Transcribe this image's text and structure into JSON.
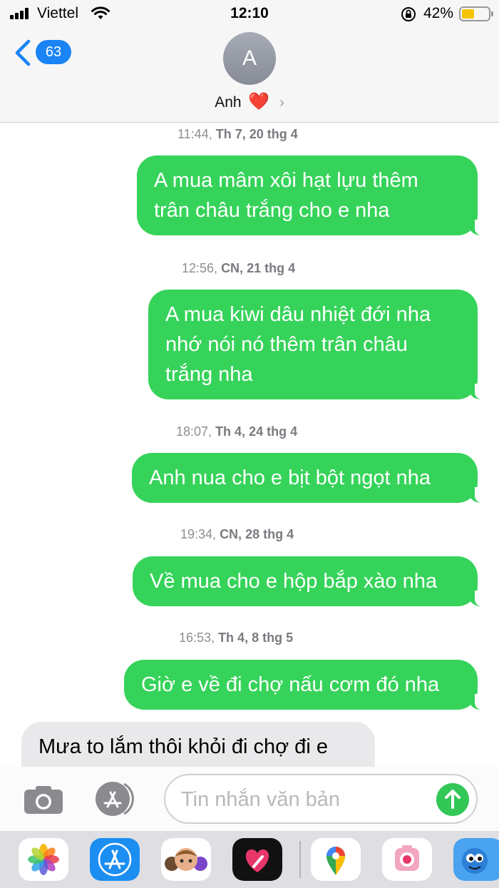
{
  "status_bar": {
    "carrier": "Viettel",
    "time": "12:10",
    "battery_percent": "42%",
    "battery_level": 0.42,
    "icons": [
      "signal-bars-icon",
      "wifi-icon",
      "rotation-lock-icon",
      "battery-icon"
    ]
  },
  "header": {
    "back_count": "63",
    "avatar_initial": "A",
    "contact_name": "Anh",
    "contact_emoji": "❤️",
    "chevron": "›"
  },
  "messages": [
    {
      "type": "timestamp",
      "time": "11:44,",
      "day": "Th 7, 20 thg 4"
    },
    {
      "type": "sent",
      "lines": [
        "A mua mâm xôi hạt lựu thêm",
        "trân châu trắng cho e nha"
      ]
    },
    {
      "type": "timestamp",
      "time": "12:56,",
      "day": "CN, 21 thg 4"
    },
    {
      "type": "sent",
      "lines": [
        "A mua kiwi dâu nhiệt đới nha",
        "nhớ nói nó thêm trân châu",
        "trắng nha"
      ]
    },
    {
      "type": "timestamp",
      "time": "18:07,",
      "day": "Th 4, 24 thg 4"
    },
    {
      "type": "sent",
      "lines": [
        "Anh nua cho e bịt bột ngọt nha"
      ]
    },
    {
      "type": "timestamp",
      "time": "19:34,",
      "day": "CN, 28 thg 4"
    },
    {
      "type": "sent",
      "lines": [
        "Về mua cho e hộp bắp xào nha"
      ]
    },
    {
      "type": "timestamp",
      "time": "16:53,",
      "day": "Th 4, 8 thg 5"
    },
    {
      "type": "sent",
      "lines": [
        "Giờ e về đi chợ nấu cơm đó nha"
      ]
    },
    {
      "type": "received",
      "lines": [
        "Mưa to lắm thôi khỏi đi chợ đi e"
      ]
    }
  ],
  "input_bar": {
    "placeholder": "Tin nhắn văn bản",
    "value": "",
    "icons": [
      "camera-icon",
      "app-store-icon",
      "send-arrow-icon"
    ]
  },
  "app_drawer": {
    "apps": [
      "photos-icon",
      "app-store-icon",
      "memoji-icon",
      "digital-touch-icon",
      "google-maps-icon",
      "camera-sticker-icon",
      "game-character-icon"
    ]
  },
  "colors": {
    "sent_bubble": "#36d35a",
    "received_bubble": "#e9e9eb",
    "badge": "#1a84f5",
    "send_button": "#33c758"
  }
}
